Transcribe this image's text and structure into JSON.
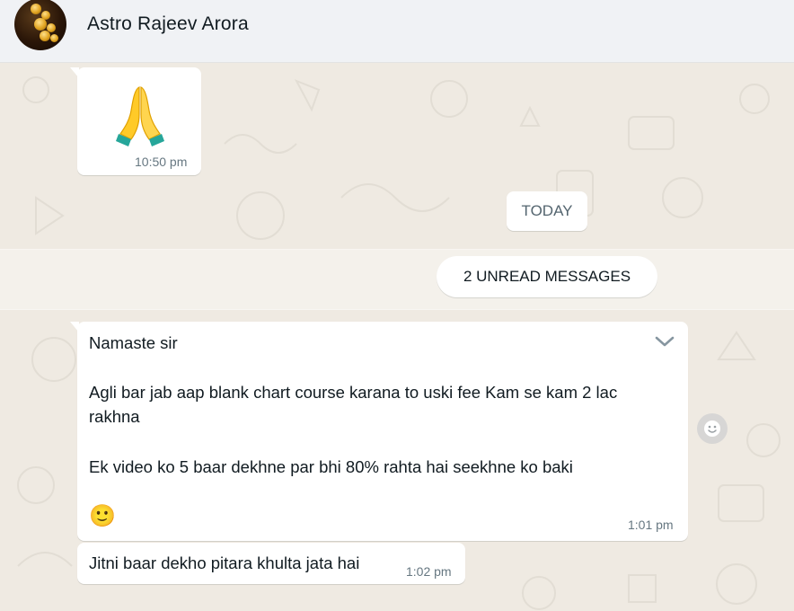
{
  "header": {
    "contact_name": "Astro Rajeev Arora",
    "avatar_icon": "astro-avatar"
  },
  "chat": {
    "earlier_message": {
      "content": "🙏",
      "time": "10:50 pm"
    },
    "date_divider": "TODAY",
    "unread_divider": "2 UNREAD MESSAGES",
    "messages": [
      {
        "lines": [
          "Namaste sir",
          "Agli bar jab aap blank chart course karana to uski fee Kam se kam 2 lac",
          "rakhna",
          "Ek video ko 5 baar dekhne par bhi 80% rahta hai seekhne ko baki",
          "🙂"
        ],
        "time": "1:01 pm",
        "menu_icon": "chevron-down-icon"
      },
      {
        "lines": [
          "Jitni baar dekho  pitara khulta jata hai"
        ],
        "time": "1:02 pm"
      }
    ],
    "reaction_icon": "emoji-smile-icon"
  },
  "colors": {
    "chat_background": "#efeae2",
    "header_background": "#f0f2f5",
    "bubble": "#ffffff",
    "timestamp": "#667781"
  }
}
